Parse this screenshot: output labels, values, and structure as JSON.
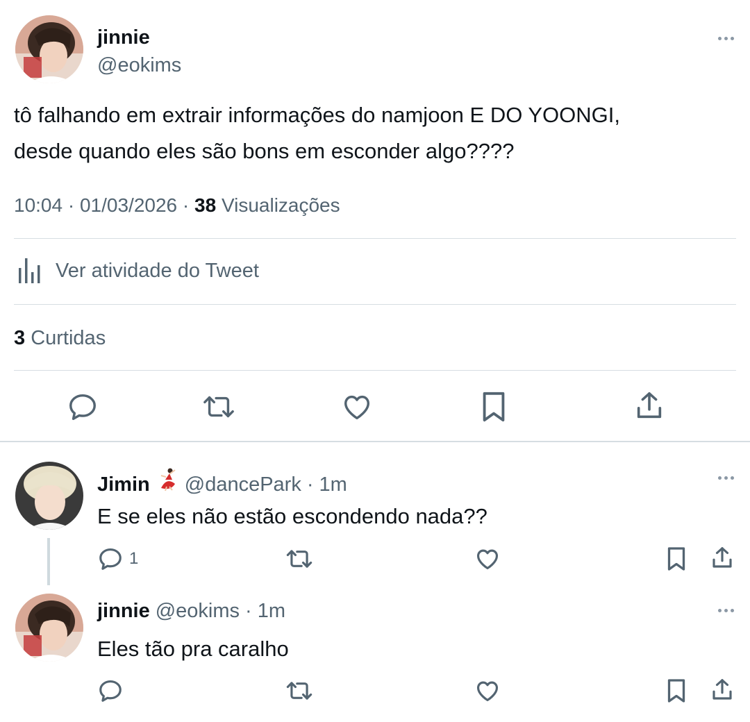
{
  "main_tweet": {
    "author_name": "jinnie",
    "author_handle": "@eokims",
    "text_line1": "tô falhando em extrair informações do namjoon E DO YOONGI,",
    "text_line2": "desde quando eles são bons em esconder algo????",
    "time": "10:04",
    "date": "01/03/2026",
    "views_count": "38",
    "views_label": "Visualizações",
    "activity_label": "Ver atividade do Tweet",
    "likes_count": "3",
    "likes_label": "Curtidas",
    "actions": [
      "reply-icon",
      "retweet-icon",
      "like-icon",
      "bookmark-icon",
      "share-icon"
    ]
  },
  "replies": [
    {
      "author_name": "Jimin",
      "author_emoji": "dancer-emoji",
      "author_handle": "@dancePark",
      "time": "· 1m",
      "text": "E se eles não estão escondendo nada??",
      "reply_count": "1"
    },
    {
      "author_name": "jinnie",
      "author_handle": "@eokims",
      "time": "· 1m",
      "text": "Eles tão pra caralho",
      "reply_count": ""
    }
  ],
  "colors": {
    "text_primary": "#0f1419",
    "text_secondary": "#536471",
    "divider": "#d6dde2",
    "icon": "#536471"
  }
}
